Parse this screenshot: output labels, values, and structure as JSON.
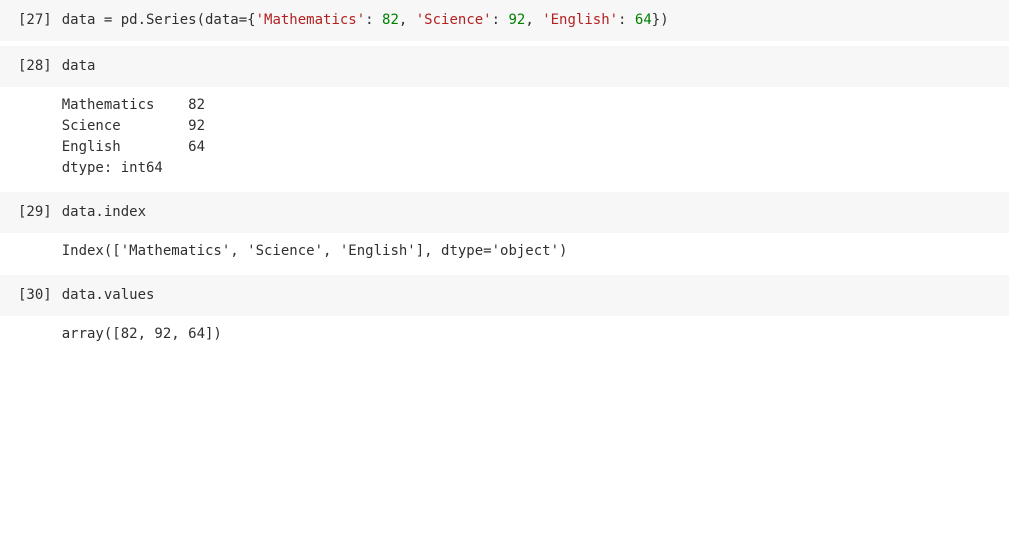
{
  "cells": [
    {
      "prompt": "[27]",
      "code": {
        "pre1": "data = pd.Series(data={",
        "str1": "'Mathematics'",
        "sep1": ": ",
        "num1": "82",
        "sep2": ", ",
        "str2": "'Science'",
        "sep3": ": ",
        "num2": "92",
        "sep4": ", ",
        "str3": "'English'",
        "sep5": ": ",
        "num3": "64",
        "post1": "})"
      }
    },
    {
      "prompt": "[28]",
      "code_text": "data",
      "output_text": "Mathematics    82\nScience        92\nEnglish        64\ndtype: int64"
    },
    {
      "prompt": "[29]",
      "code_text": "data.index",
      "output_text": "Index(['Mathematics', 'Science', 'English'], dtype='object')"
    },
    {
      "prompt": "[30]",
      "code_text": "data.values",
      "output_text": "array([82, 92, 64])"
    }
  ]
}
